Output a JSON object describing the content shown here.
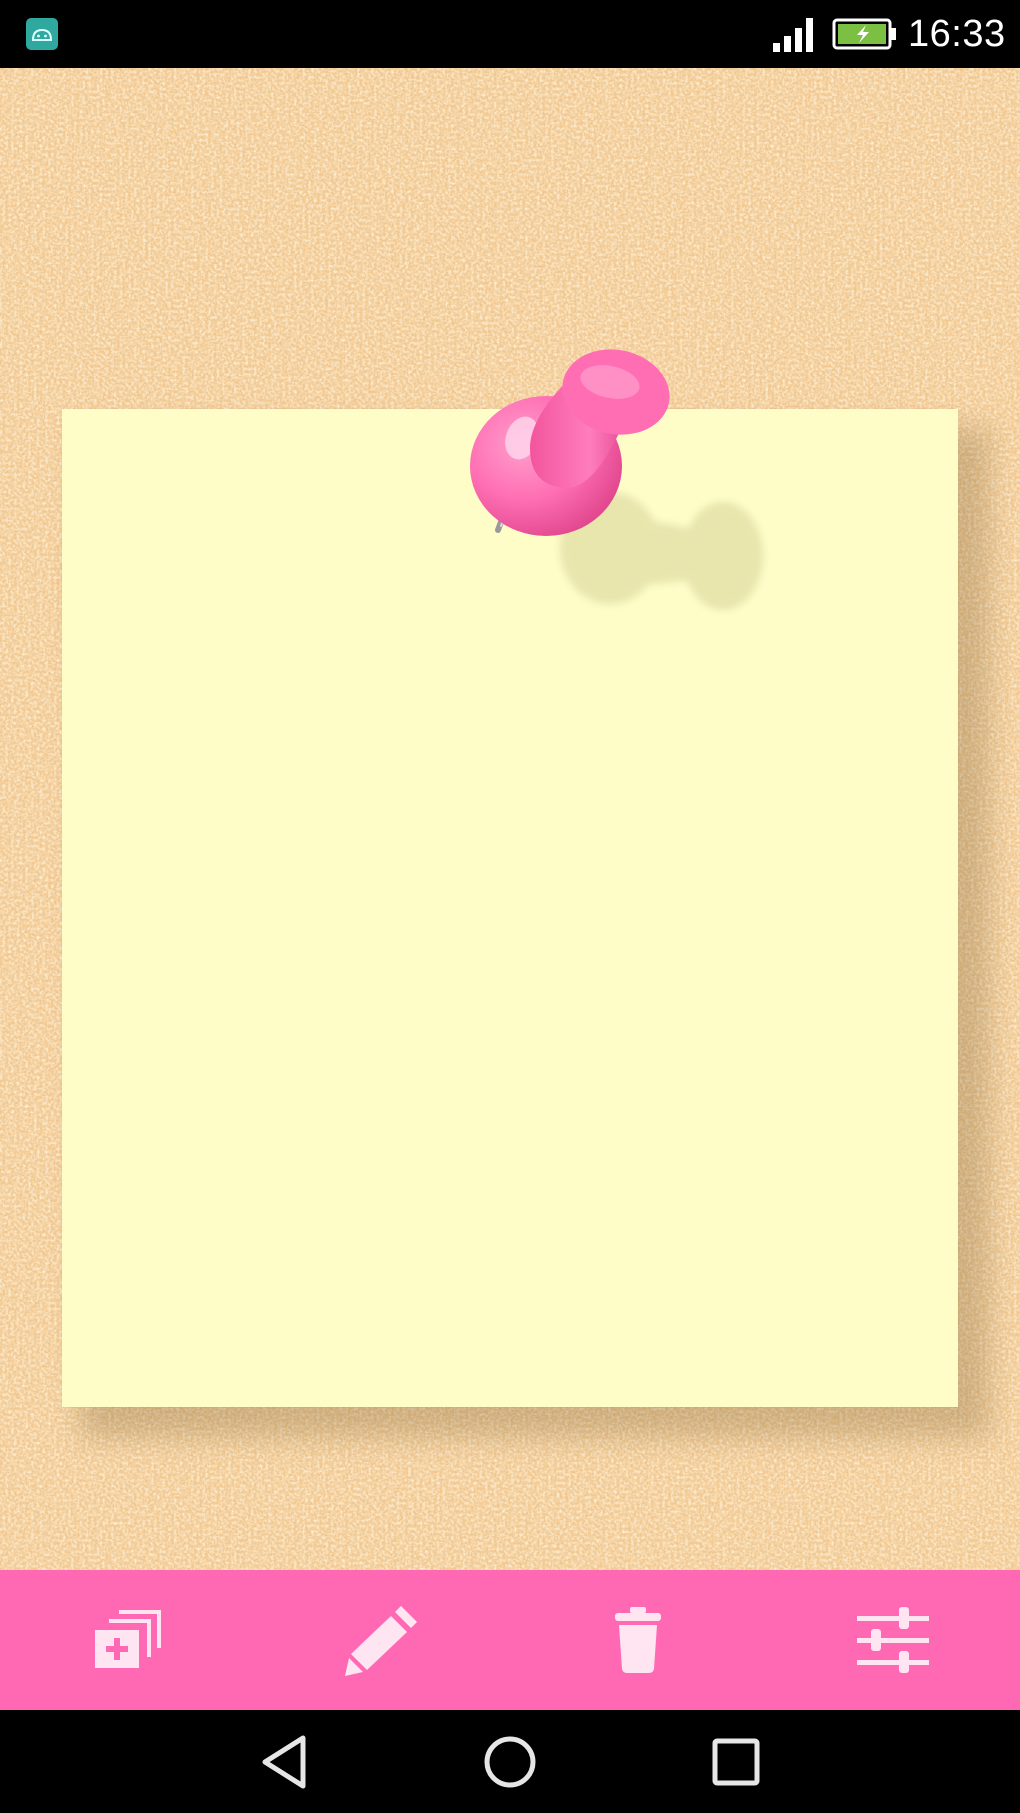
{
  "status_bar": {
    "time": "16:33",
    "icons": {
      "notification": "android-app-icon",
      "signal": "signal-icon",
      "battery": "battery-charging-icon"
    }
  },
  "board": {
    "background": "cork",
    "note": {
      "color": "#fefdc8",
      "pin_color": "#ff69b4",
      "text": ""
    }
  },
  "action_bar": {
    "color": "#ff69b4",
    "buttons": [
      {
        "icon": "add-note-icon"
      },
      {
        "icon": "pencil-icon"
      },
      {
        "icon": "trash-icon"
      },
      {
        "icon": "sliders-icon"
      }
    ]
  },
  "nav_bar": {
    "buttons": [
      {
        "icon": "back-icon"
      },
      {
        "icon": "home-icon"
      },
      {
        "icon": "recents-icon"
      }
    ]
  }
}
